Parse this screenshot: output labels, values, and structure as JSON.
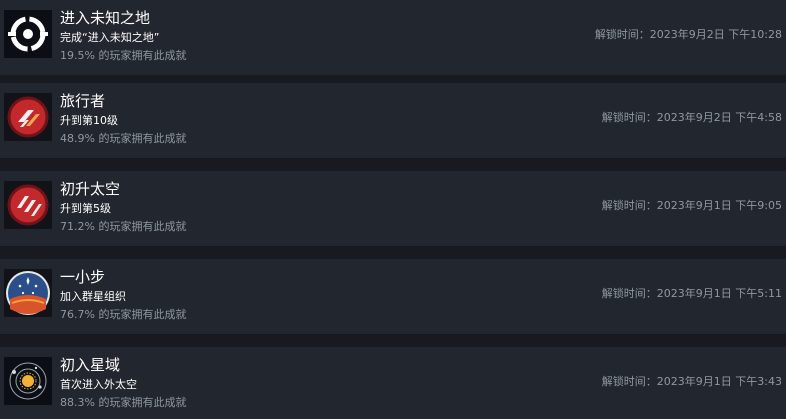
{
  "achievements": [
    {
      "title": "进入未知之地",
      "description": "完成“进入未知之地”",
      "percent": "19.5% 的玩家拥有此成就",
      "unlock": "解锁时间：2023年9月2日 下午10:28",
      "icon": "target-ring-icon"
    },
    {
      "title": "旅行者",
      "description": "升到第10级",
      "percent": "48.9% 的玩家拥有此成就",
      "unlock": "解锁时间：2023年9月2日 下午4:58",
      "icon": "rank-chevron-icon"
    },
    {
      "title": "初升太空",
      "description": "升到第5级",
      "percent": "71.2% 的玩家拥有此成就",
      "unlock": "解锁时间：2023年9月1日 下午9:05",
      "icon": "rank-stripes-icon"
    },
    {
      "title": "一小步",
      "description": "加入群星组织",
      "percent": "76.7% 的玩家拥有此成就",
      "unlock": "解锁时间：2023年9月1日 下午5:11",
      "icon": "constellation-planet-icon"
    },
    {
      "title": "初入星域",
      "description": "首次进入外太空",
      "percent": "88.3% 的玩家拥有此成就",
      "unlock": "解锁时间：2023年9月1日 下午3:43",
      "icon": "solar-orbit-icon"
    }
  ],
  "colors": {
    "page_bg": "#171a21",
    "row_bg": "#22262e",
    "title": "#ffffff",
    "muted": "#8f98a0",
    "badge_red": "#c3282d",
    "planet_blue": "#2a4f8a"
  }
}
